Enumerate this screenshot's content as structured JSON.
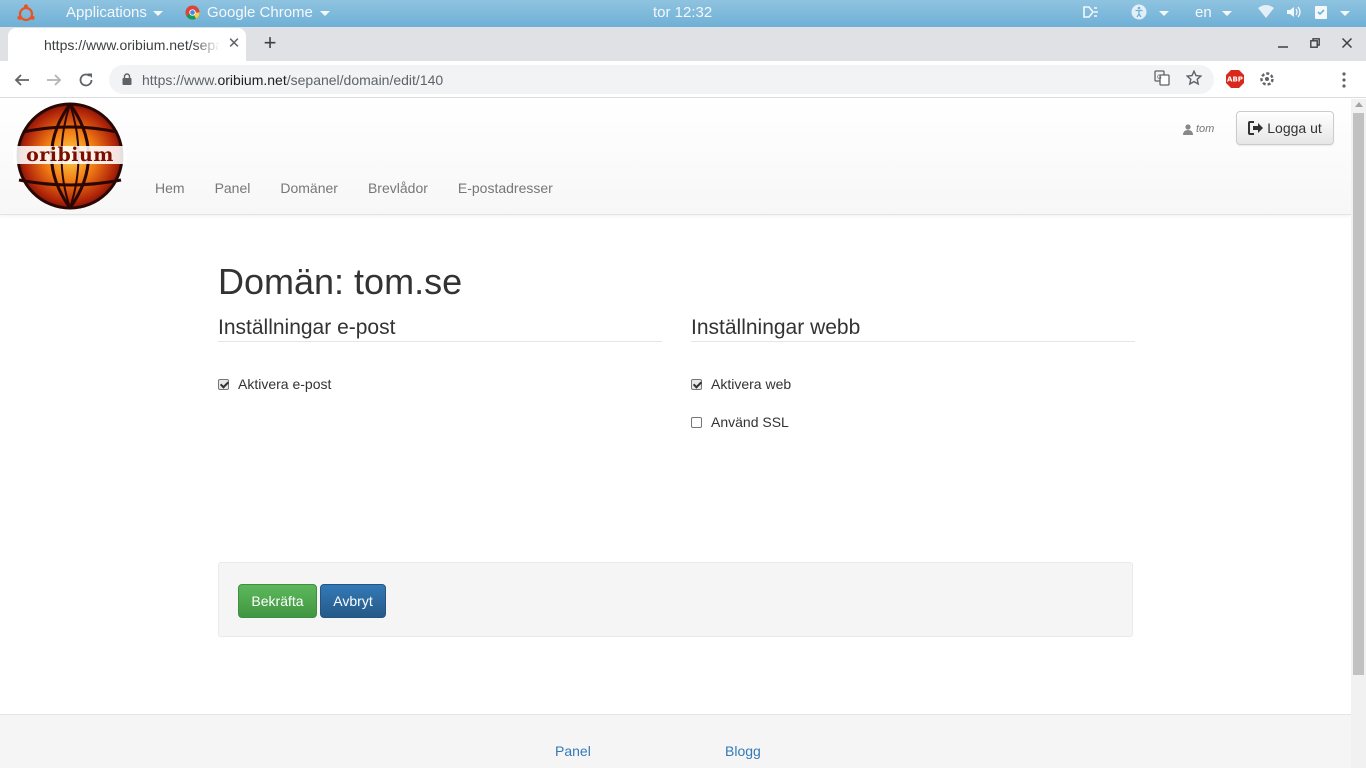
{
  "gnome": {
    "applications_label": "Applications",
    "active_app_label": "Google Chrome",
    "clock": "tor 12:32",
    "input_language": "en"
  },
  "browser": {
    "tab_title": "https://www.oribium.net/sepanel/domain/edit/140",
    "url_prefix": "https://www.",
    "url_host": "oribium.net",
    "url_path": "/sepanel/domain/edit/140",
    "abp_label": "ABP",
    "icons": {
      "back": "back-arrow-icon",
      "forward": "forward-arrow-icon",
      "reload": "reload-icon",
      "lock": "lock-icon",
      "translate": "translate-icon",
      "bookmark": "star-icon",
      "menu": "kebab-menu-icon"
    }
  },
  "site": {
    "logo_text": "oribium",
    "nav": [
      "Hem",
      "Panel",
      "Domäner",
      "Brevlådor",
      "E-postadresser"
    ],
    "username": "tom",
    "logout_label": "Logga ut"
  },
  "page": {
    "title": "Domän: tom.se",
    "email_section": {
      "heading": "Inställningar e-post",
      "options": [
        {
          "label": "Aktivera e-post",
          "checked": true
        }
      ]
    },
    "web_section": {
      "heading": "Inställningar webb",
      "options": [
        {
          "label": "Aktivera web",
          "checked": true
        },
        {
          "label": "Använd SSL",
          "checked": false
        }
      ]
    },
    "confirm_label": "Bekräfta",
    "cancel_label": "Avbryt"
  },
  "footer": {
    "links": [
      "Panel",
      "Blogg"
    ]
  },
  "colors": {
    "link": "#337ab7",
    "success": "#5cb85c",
    "primary": "#337ab7",
    "nav_text": "#777777"
  }
}
